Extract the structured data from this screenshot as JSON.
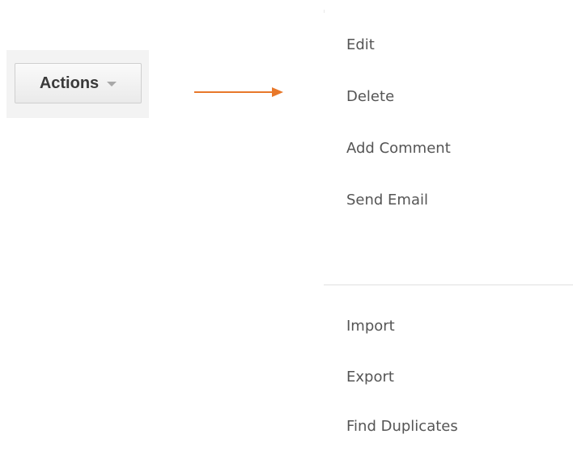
{
  "actions_button": {
    "label": "Actions",
    "icon": "chevron-down-icon"
  },
  "arrow": {
    "color": "#e8782a"
  },
  "menu": {
    "group1": [
      "Edit",
      "Delete",
      "Add Comment",
      "Send Email"
    ],
    "group2": [
      "Import",
      "Export",
      "Find Duplicates"
    ]
  }
}
